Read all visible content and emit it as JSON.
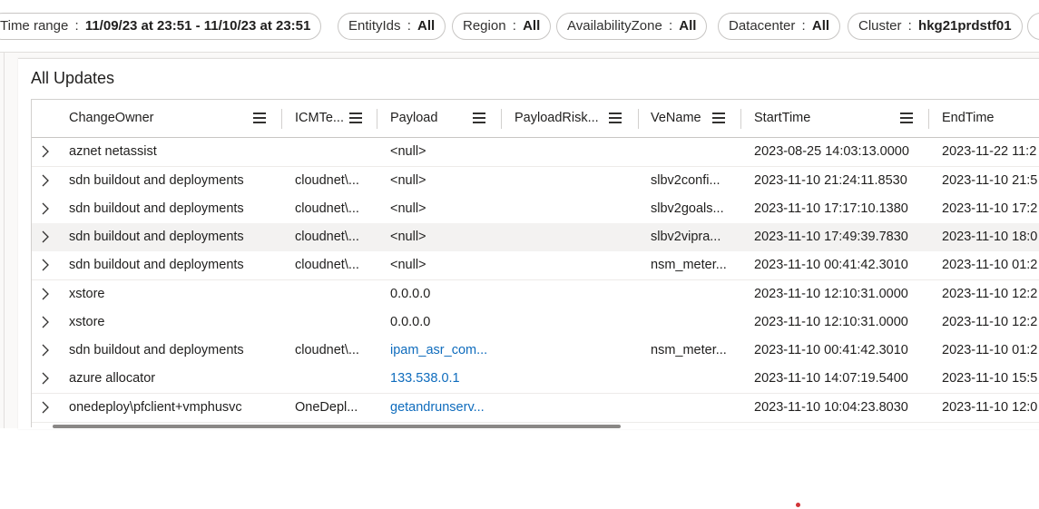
{
  "filters": [
    {
      "label": "Time range",
      "value": "11/09/23 at 23:51 - 11/10/23 at 23:51"
    },
    {
      "label": "EntityIds",
      "value": "All"
    },
    {
      "label": "Region",
      "value": "All"
    },
    {
      "label": "AvailabilityZone",
      "value": "All"
    },
    {
      "label": "Datacenter",
      "value": "All"
    },
    {
      "label": "Cluster",
      "value": "hkg21prdstf01"
    }
  ],
  "panel": {
    "title": "All Updates",
    "columns": [
      "ChangeOwner",
      "ICMTe...",
      "Payload",
      "PayloadRisk...",
      "VeName",
      "StartTime",
      "EndTime"
    ],
    "rows": [
      {
        "owner": "aznet netassist",
        "icm": "",
        "payload": "<null>",
        "payload_link": false,
        "risk": "",
        "vename": "",
        "start": "2023-08-25 14:03:13.0000",
        "end": "2023-11-22 11:2"
      },
      {
        "owner": "sdn buildout and deployments",
        "icm": "cloudnet\\...",
        "payload": "<null>",
        "payload_link": false,
        "risk": "",
        "vename": "slbv2confi...",
        "start": "2023-11-10 21:24:11.8530",
        "end": "2023-11-10 21:5"
      },
      {
        "owner": "sdn buildout and deployments",
        "icm": "cloudnet\\...",
        "payload": "<null>",
        "payload_link": false,
        "risk": "",
        "vename": "slbv2goals...",
        "start": "2023-11-10 17:17:10.1380",
        "end": "2023-11-10 17:2"
      },
      {
        "owner": "sdn buildout and deployments",
        "icm": "cloudnet\\...",
        "payload": "<null>",
        "payload_link": false,
        "risk": "",
        "vename": "slbv2vipra...",
        "start": "2023-11-10 17:49:39.7830",
        "end": "2023-11-10 18:0"
      },
      {
        "owner": "sdn buildout and deployments",
        "icm": "cloudnet\\...",
        "payload": "<null>",
        "payload_link": false,
        "risk": "",
        "vename": "nsm_meter...",
        "start": "2023-11-10 00:41:42.3010",
        "end": "2023-11-10 01:2"
      },
      {
        "owner": "xstore",
        "icm": "",
        "payload": "0.0.0.0",
        "payload_link": false,
        "risk": "",
        "vename": "",
        "start": "2023-11-10 12:10:31.0000",
        "end": "2023-11-10 12:2"
      },
      {
        "owner": "xstore",
        "icm": "",
        "payload": "0.0.0.0",
        "payload_link": false,
        "risk": "",
        "vename": "",
        "start": "2023-11-10 12:10:31.0000",
        "end": "2023-11-10 12:2"
      },
      {
        "owner": "sdn buildout and deployments",
        "icm": "cloudnet\\...",
        "payload": "ipam_asr_com...",
        "payload_link": true,
        "risk": "",
        "vename": "nsm_meter...",
        "start": "2023-11-10 00:41:42.3010",
        "end": "2023-11-10 01:2"
      },
      {
        "owner": "azure allocator",
        "icm": "",
        "payload": "133.538.0.1",
        "payload_link": true,
        "risk": "",
        "vename": "",
        "start": "2023-11-10 14:07:19.5400",
        "end": "2023-11-10 15:5"
      },
      {
        "owner": "onedeploy\\pfclient+vmphusvc",
        "icm": "OneDepl...",
        "payload": "getandrunserv...",
        "payload_link": true,
        "risk": "",
        "vename": "",
        "start": "2023-11-10 10:04:23.8030",
        "end": "2023-11-10 12:0"
      }
    ]
  },
  "colors": {
    "link": "#0f6cbd",
    "hover_row": "#f3f2f1",
    "accent_dot": "#d13438"
  },
  "icons": {
    "row_expand": "chevron-right-icon",
    "column_menu": "hamburger-menu-icon"
  }
}
